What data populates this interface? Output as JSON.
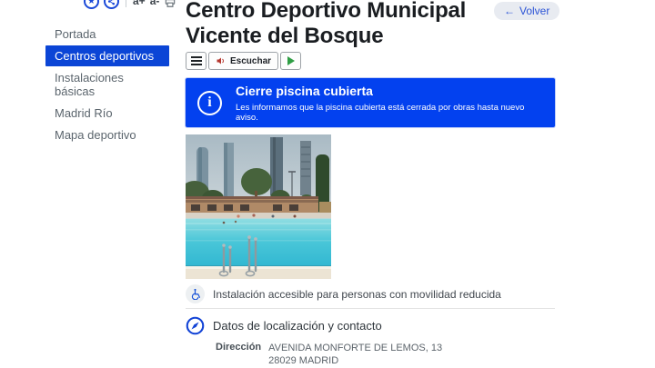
{
  "colors": {
    "brand_blue": "#0b45d6",
    "alert_blue": "#0341ef",
    "link_blue": "#2b53d6",
    "water_teal": "#49c6d8"
  },
  "icons": {
    "favorite_glyph": "★"
  },
  "quick_actions": {
    "text_increase_label": "a+",
    "text_decrease_label": "a-"
  },
  "sidebar": {
    "items": [
      {
        "label": "Portada"
      },
      {
        "label": "Centros deportivos"
      },
      {
        "label": "Instalaciones básicas"
      },
      {
        "label": "Madrid Río"
      },
      {
        "label": "Mapa deportivo"
      }
    ]
  },
  "header": {
    "title": "Centro Deportivo Municipal Vicente del Bosque",
    "back_arrow": "←",
    "back_label": "Volver"
  },
  "listen_toolbar": {
    "listen_label": "Escuchar"
  },
  "alert": {
    "icon_glyph": "i",
    "title": "Cierre piscina cubierta",
    "message": "Les informamos que la piscina cubierta está cerrada por obras hasta nuevo aviso."
  },
  "accessibility": {
    "text": "Instalación accesible para personas con movilidad reducida"
  },
  "location": {
    "heading": "Datos de localización y contacto",
    "address_label": "Dirección",
    "address_line1": "AVENIDA MONFORTE DE LEMOS, 13",
    "address_line2": "28029 MADRID"
  },
  "photo": {
    "description": "Piscina exterior con las cuatro torres de Madrid al fondo"
  }
}
